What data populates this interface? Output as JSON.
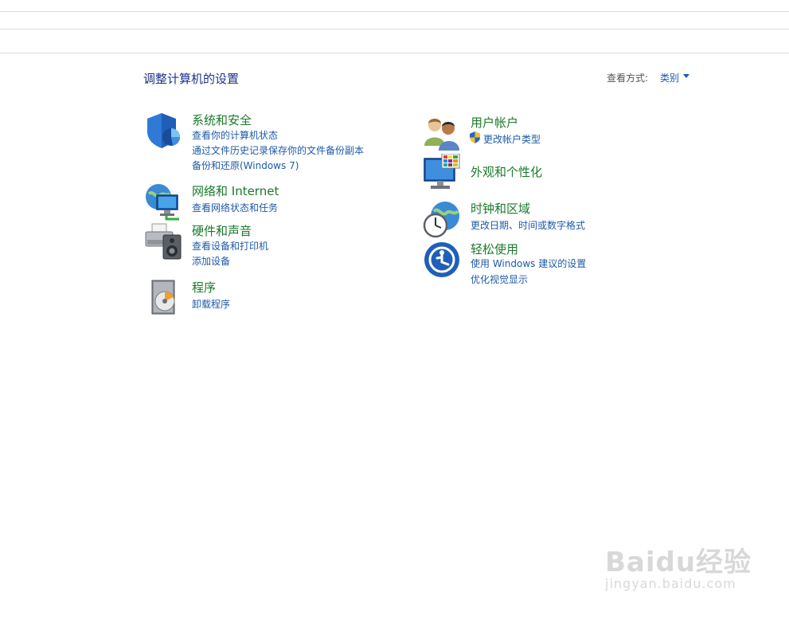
{
  "header": {
    "title": "调整计算机的设置",
    "view_by_label": "查看方式:",
    "view_by_value": "类别"
  },
  "left": [
    {
      "id": "system-security",
      "icon": "shield-icon",
      "title": "系统和安全",
      "links": [
        "查看你的计算机状态",
        "通过文件历史记录保存你的文件备份副本",
        "备份和还原(Windows 7)"
      ]
    },
    {
      "id": "network-internet",
      "icon": "network-globe-icon",
      "title": "网络和 Internet",
      "links": [
        "查看网络状态和任务"
      ]
    },
    {
      "id": "hardware-sound",
      "icon": "printer-speaker-icon",
      "title": "硬件和声音",
      "links": [
        "查看设备和打印机",
        "添加设备"
      ]
    },
    {
      "id": "programs",
      "icon": "programs-disc-icon",
      "title": "程序",
      "links": [
        "卸载程序"
      ]
    }
  ],
  "right": [
    {
      "id": "user-accounts",
      "icon": "users-icon",
      "title": "用户帐户",
      "links": [
        "更改帐户类型"
      ]
    },
    {
      "id": "appearance",
      "icon": "monitor-colors-icon",
      "title": "外观和个性化",
      "links": []
    },
    {
      "id": "clock-region",
      "icon": "clock-globe-icon",
      "title": "时钟和区域",
      "links": [
        "更改日期、时间或数字格式"
      ]
    },
    {
      "id": "ease-of-access",
      "icon": "ease-of-access-icon",
      "title": "轻松使用",
      "links": [
        "使用 Windows 建议的设置",
        "优化视觉显示"
      ]
    }
  ],
  "watermark": {
    "line1": "Baidu经验",
    "line2": "jingyan.baidu.com"
  }
}
